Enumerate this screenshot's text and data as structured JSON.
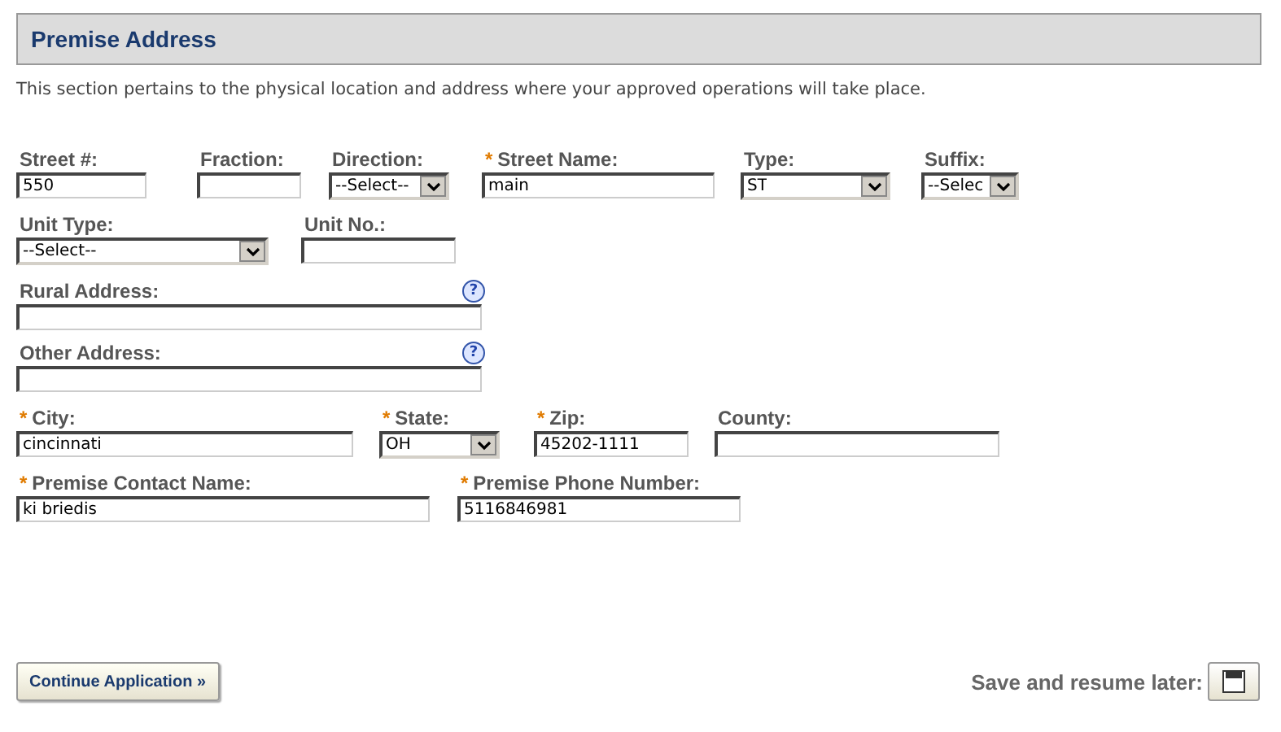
{
  "section": {
    "title": "Premise Address",
    "intro": "This section pertains to the physical location and address where your approved operations will take place."
  },
  "rows": [
    [
      {
        "label": "Street #:",
        "kind": "text",
        "value": "550"
      },
      {
        "label": "Fraction:",
        "kind": "text"
      },
      {
        "label": "Direction:",
        "kind": "select",
        "value": "--Select--"
      },
      {
        "label": "Street Name:",
        "mark": "*",
        "kind": "text",
        "value": "main"
      },
      {
        "label": "Type:",
        "kind": "select",
        "value": "ST"
      },
      {
        "label": "Suffix:",
        "kind": "select",
        "value": "--Selec"
      }
    ],
    [
      {
        "label": "Unit Type:",
        "kind": "select",
        "value": "--Select--"
      },
      {
        "label": "Unit No.:",
        "kind": "text"
      }
    ],
    [
      {
        "label": "Rural Address:",
        "kind": "text",
        "help": "?"
      }
    ],
    [
      {
        "label": "Other Address:",
        "kind": "text",
        "help": "?"
      }
    ],
    [
      {
        "label": "City:",
        "mark": "*",
        "kind": "text",
        "value": "cincinnati"
      },
      {
        "label": "State:",
        "mark": "*",
        "kind": "select",
        "value": "OH"
      },
      {
        "label": "Zip:",
        "mark": "*",
        "kind": "text",
        "value": "45202-1111"
      },
      {
        "label": "County:",
        "kind": "text"
      }
    ],
    [
      {
        "label": "Premise Contact Name:",
        "mark": "*",
        "kind": "text",
        "value": "ki briedis"
      },
      {
        "label": "Premise Phone Number:",
        "mark": "*",
        "kind": "text",
        "value": "5116846981"
      }
    ]
  ],
  "continue_button": "Continue Application »",
  "save_label": "Save and resume later:"
}
